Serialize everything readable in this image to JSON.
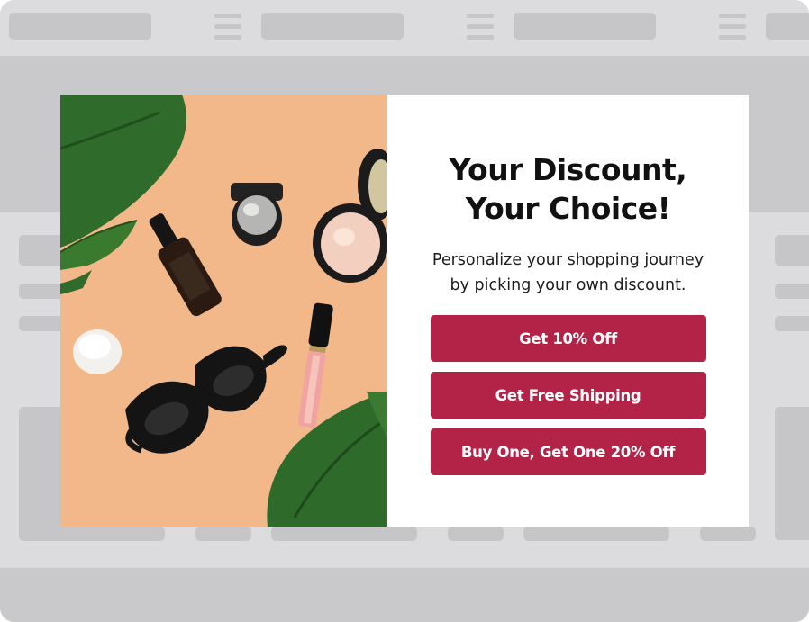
{
  "popup": {
    "headline_line1": "Your Discount,",
    "headline_line2": "Your Choice!",
    "subtext_line1": "Personalize your shopping journey",
    "subtext_line2": "by picking your own discount.",
    "options": [
      {
        "label": "Get 10% Off"
      },
      {
        "label": "Get Free Shipping"
      },
      {
        "label": "Buy One, Get One 20% Off"
      }
    ]
  },
  "colors": {
    "button": "#b22347",
    "photo_background": "#f2b889",
    "skeleton": "#c6c6c8",
    "frame": "#dcdcde"
  },
  "image": {
    "subject": "flat-lay cosmetics with sunglasses, candle and monstera leaves"
  }
}
